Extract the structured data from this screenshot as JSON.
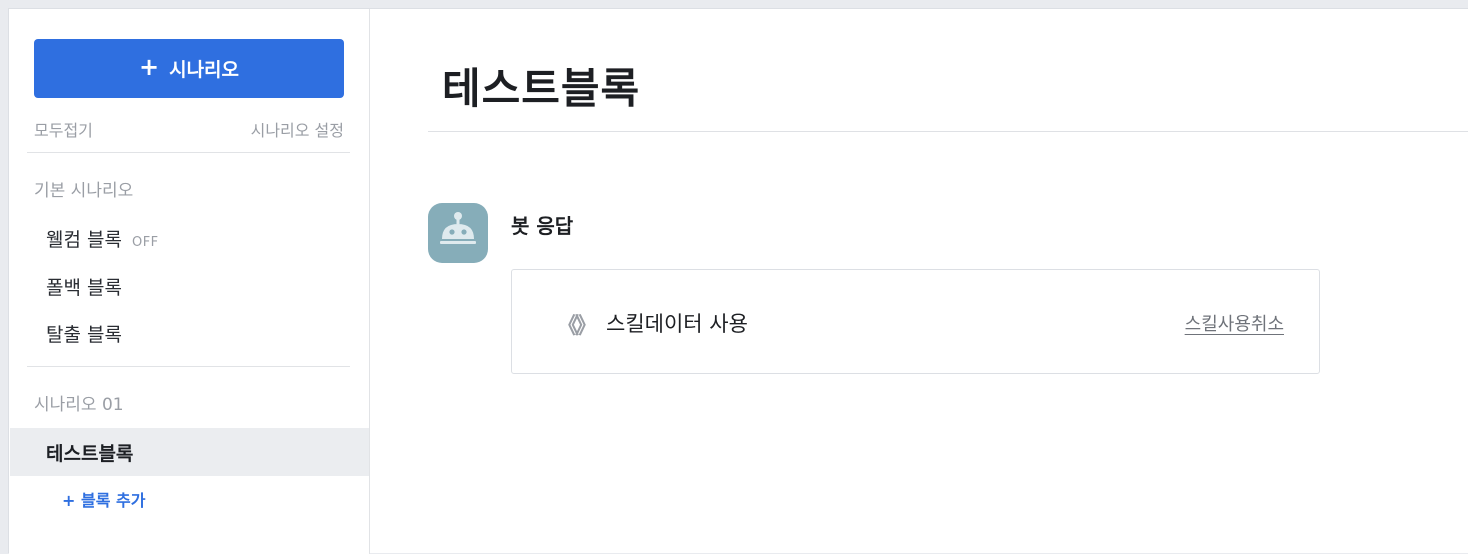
{
  "sidebar": {
    "add_button_label": "시나리오",
    "add_button_icon": "plus-icon",
    "collapse_all": "모두접기",
    "scenario_settings": "시나리오 설정",
    "default_section": {
      "title": "기본 시나리오",
      "items": [
        {
          "label": "웰컴 블록",
          "badge": "OFF"
        },
        {
          "label": "폴백 블록",
          "badge": ""
        },
        {
          "label": "탈출 블록",
          "badge": ""
        }
      ]
    },
    "scenario_section": {
      "title": "시나리오 01",
      "selected_item": "테스트블록",
      "add_block": "+ 블록 추가"
    }
  },
  "main": {
    "title": "테스트블록",
    "bot_response": {
      "name": "봇 응답",
      "avatar_icon": "robot-icon",
      "skill_icon": "code-brackets-icon",
      "skill_label": "스킬데이터 사용",
      "cancel_label": "스킬사용취소"
    }
  },
  "colors": {
    "accent": "#2f6fe0",
    "avatar_bg": "#86adb9",
    "selected_bg": "#ebedf0",
    "muted_text": "#9a9ea5"
  }
}
